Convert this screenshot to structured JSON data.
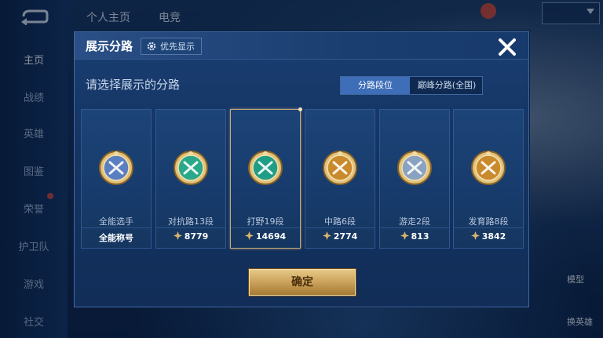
{
  "sidebar": {
    "items": [
      {
        "label": "主页",
        "active": true
      },
      {
        "label": "战绩"
      },
      {
        "label": "英雄"
      },
      {
        "label": "图鉴"
      },
      {
        "label": "荣誉"
      },
      {
        "label": "护卫队"
      },
      {
        "label": "游戏"
      },
      {
        "label": "社交"
      }
    ]
  },
  "topbar": {
    "tabs": [
      "个人主页",
      "电竞"
    ]
  },
  "right_labels": {
    "model": "模型",
    "swap_hero": "换英雄"
  },
  "modal": {
    "title": "展示分路",
    "pref_button": "优先显示",
    "subtitle": "请选择展示的分路",
    "segments": [
      {
        "label": "分路段位",
        "active": true
      },
      {
        "label": "巅峰分路(全国)",
        "active": false
      }
    ],
    "cards": [
      {
        "name": "全能选手",
        "score": "全能称号",
        "icon": "all-round-emblem-icon",
        "color": "#5a7fc0",
        "show_points": false,
        "selected": false
      },
      {
        "name": "对抗路13段",
        "score": "8779",
        "icon": "clash-lane-emblem-icon",
        "color": "#2aa88a",
        "show_points": true,
        "selected": false
      },
      {
        "name": "打野19段",
        "score": "14694",
        "icon": "jungle-emblem-icon",
        "color": "#1f9e86",
        "show_points": true,
        "selected": true
      },
      {
        "name": "中路6段",
        "score": "2774",
        "icon": "mid-lane-emblem-icon",
        "color": "#c98a2c",
        "show_points": true,
        "selected": false
      },
      {
        "name": "游走2段",
        "score": "813",
        "icon": "roam-emblem-icon",
        "color": "#8aa2c2",
        "show_points": true,
        "selected": false
      },
      {
        "name": "发育路8段",
        "score": "3842",
        "icon": "farm-lane-emblem-icon",
        "color": "#c98a2c",
        "show_points": true,
        "selected": false
      }
    ],
    "confirm_label": "确定"
  },
  "colors": {
    "accent_gold": "#caa15a",
    "panel_blue": "#173b6c",
    "segment_active": "#3e6eb8"
  }
}
